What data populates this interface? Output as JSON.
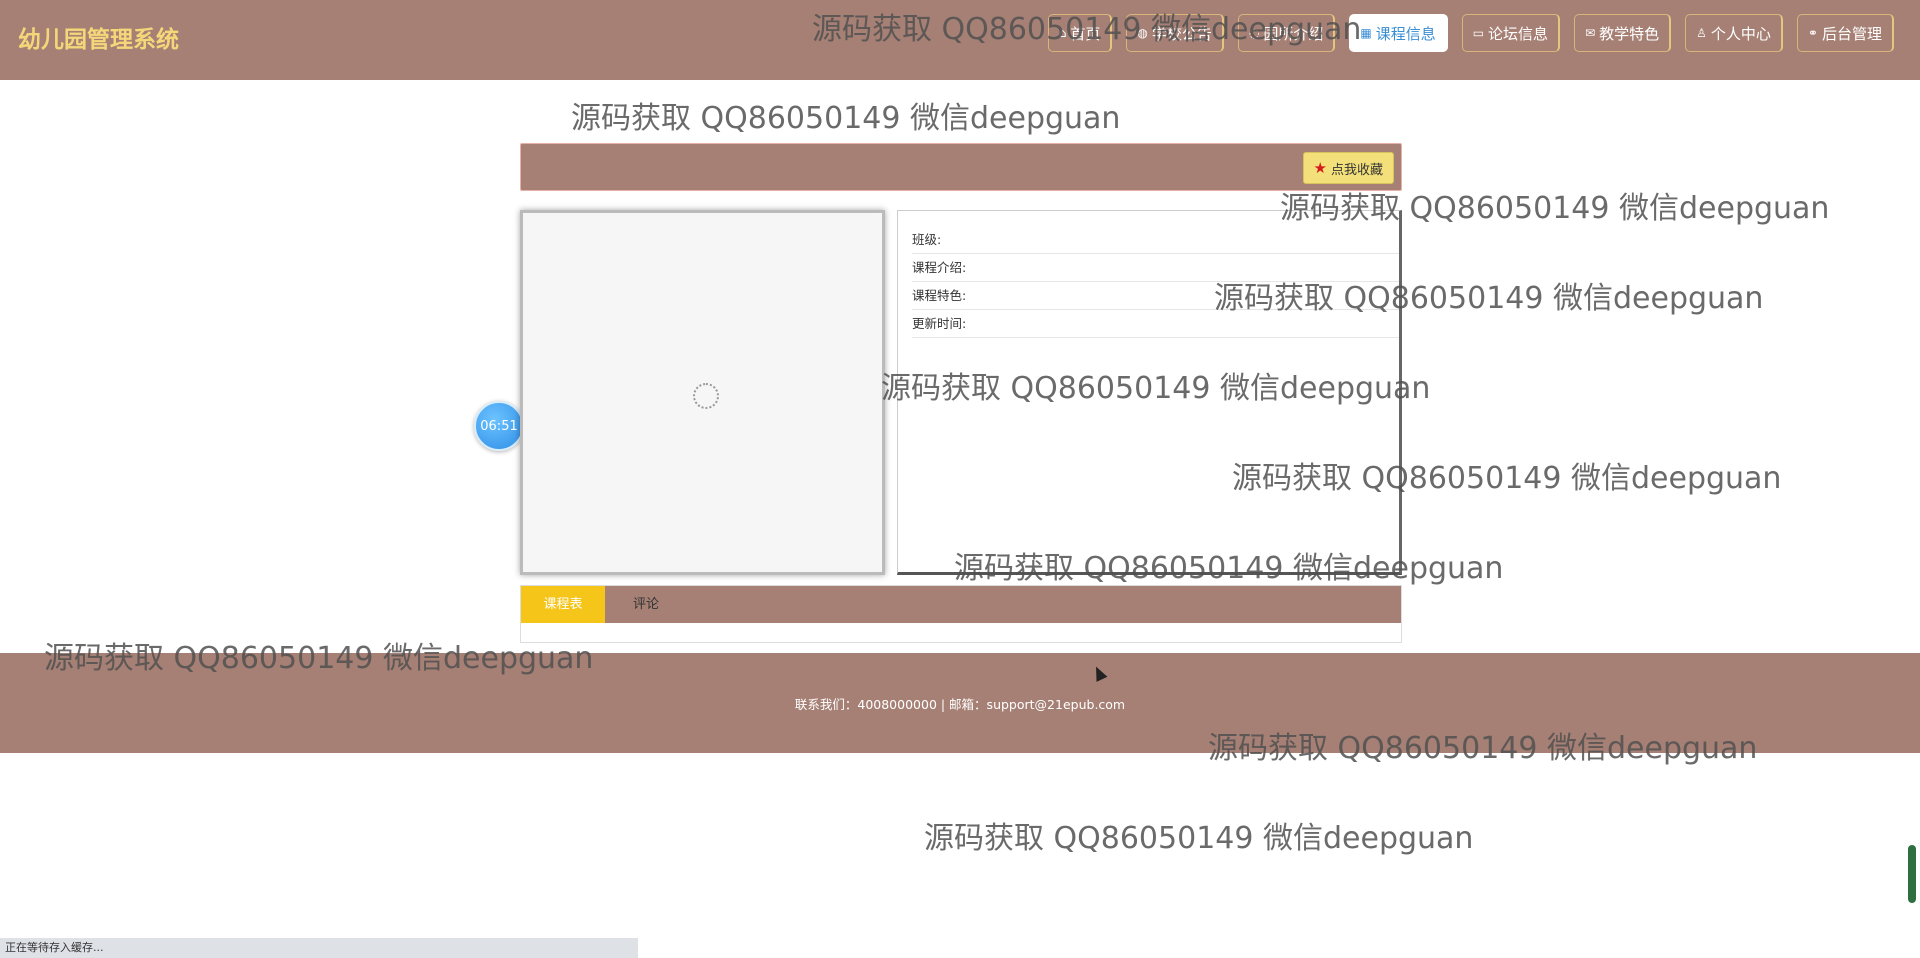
{
  "header": {
    "brand": "幼儿园管理系统",
    "nav": [
      {
        "icon": "home-icon",
        "glyph": "⌂",
        "label": "首页"
      },
      {
        "icon": "globe-icon",
        "glyph": "◍",
        "label": "学校公告"
      },
      {
        "icon": "location-icon",
        "glyph": "◌",
        "label": "园所介绍"
      },
      {
        "icon": "calendar-icon",
        "glyph": "▦",
        "label": "课程信息"
      },
      {
        "icon": "book-icon",
        "glyph": "▭",
        "label": "论坛信息"
      },
      {
        "icon": "mail-icon",
        "glyph": "✉",
        "label": "教学特色"
      },
      {
        "icon": "user-icon",
        "glyph": "♙",
        "label": "个人中心"
      },
      {
        "icon": "link-icon",
        "glyph": "⚭",
        "label": "后台管理"
      }
    ],
    "active_index": 3
  },
  "detail": {
    "favorite_label": "点我收藏",
    "fields": [
      {
        "label": "班级:",
        "value": ""
      },
      {
        "label": "课程介绍:",
        "value": ""
      },
      {
        "label": "课程特色:",
        "value": ""
      },
      {
        "label": "更新时间:",
        "value": ""
      }
    ]
  },
  "tabs": {
    "schedule": "课程表",
    "comment": "评论"
  },
  "timer": "06:51",
  "footer": {
    "contact": "联系我们：4008000000 | 邮箱：support@21epub.com"
  },
  "watermark": "源码获取 QQ86050149 微信deepguan",
  "status_bar": "正在等待存入缓存..."
}
